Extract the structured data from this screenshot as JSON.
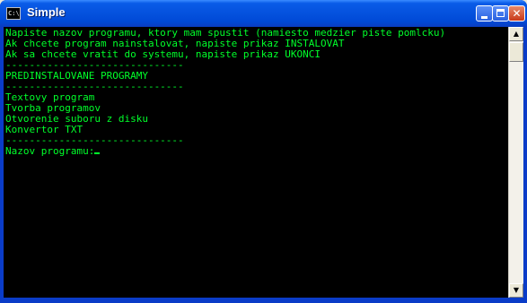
{
  "window": {
    "title": "Simple",
    "icon_label": "C:\\"
  },
  "console": {
    "lines": [
      "Napiste nazov programu, ktory mam spustit (namiesto medzier piste pomlcku)",
      "Ak chcete program nainstalovat, napiste prikaz INSTALOVAT",
      "Ak sa chcete vratit do systemu, napiste prikaz UKONCI",
      "------------------------------",
      "PREDINSTALOVANE PROGRAMY",
      "------------------------------",
      "Textovy program",
      "Tvorba programov",
      "Otvorenie suboru z disku",
      "Konvertor TXT",
      "------------------------------",
      "Nazov programu:"
    ],
    "text_color": "#00ff2a",
    "background": "#000000"
  },
  "colors": {
    "titlebar": "#0a5ce8",
    "close_button": "#c8391a"
  },
  "icons": {
    "minimize": "minimize-icon",
    "maximize": "maximize-icon",
    "close": "close-icon",
    "scroll_up": "arrow-up-icon",
    "scroll_down": "arrow-down-icon"
  }
}
